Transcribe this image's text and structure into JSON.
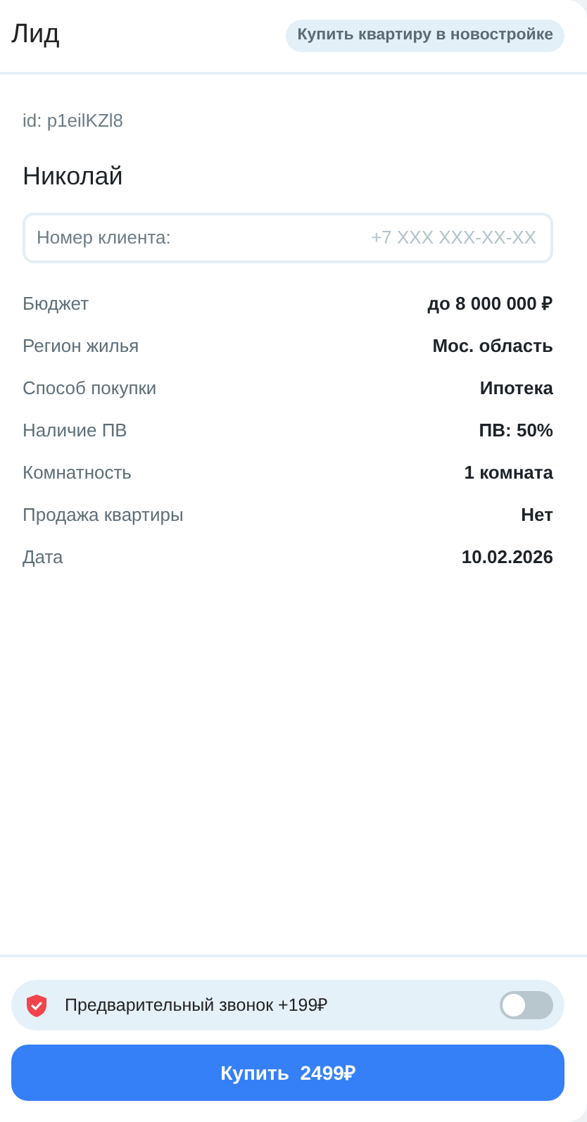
{
  "header": {
    "title": "Лид",
    "tag": "Купить квартиру в новостройке"
  },
  "lead": {
    "id": "id: p1eilKZl8",
    "name": "Николай"
  },
  "phone_field": {
    "label": "Номер клиента:",
    "placeholder": "+7 XXX XXX-XX-XX"
  },
  "details": [
    {
      "label": "Бюджет",
      "value": "до 8 000 000 ₽"
    },
    {
      "label": "Регион жилья",
      "value": "Мос. область"
    },
    {
      "label": "Способ покупки",
      "value": "Ипотека"
    },
    {
      "label": "Наличие ПВ",
      "value": "ПВ: 50%"
    },
    {
      "label": "Комнатность",
      "value": "1 комната"
    },
    {
      "label": "Продажа квартиры",
      "value": "Нет"
    },
    {
      "label": "Дата",
      "value": "10.02.2026"
    }
  ],
  "precall": {
    "label": "Предварительный звонок +199₽",
    "on": false
  },
  "buy_button": "Купить  2499₽"
}
